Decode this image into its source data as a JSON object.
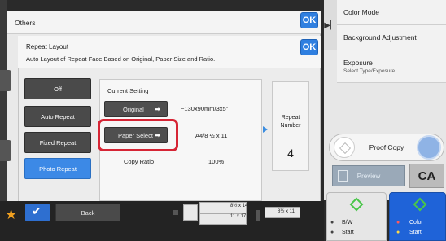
{
  "outer_dialog": {
    "title": "Others",
    "ok_label": "OK"
  },
  "inner_dialog": {
    "title": "Repeat Layout",
    "description": "Auto Layout of Repeat Face Based on Original, Paper Size and Ratio.",
    "ok_label": "OK"
  },
  "modes": [
    {
      "label": "Off",
      "active": false
    },
    {
      "label": "Auto Repeat",
      "active": false
    },
    {
      "label": "Fixed Repeat",
      "active": false
    },
    {
      "label": "Photo Repeat",
      "active": true
    }
  ],
  "current_setting": {
    "title": "Current Setting",
    "original_label": "Original",
    "original_value": "~130x90mm/3x5\"",
    "paper_select_label": "Paper Select",
    "paper_select_value": "A4/8 ½ x 11",
    "copy_ratio_label": "Copy Ratio",
    "copy_ratio_value": "100%"
  },
  "repeat_number": {
    "label": "Repeat Number",
    "value": "4"
  },
  "right_panel": {
    "color_mode": "Color Mode",
    "background_adjustment": "Background Adjustment",
    "exposure": "Exposure",
    "exposure_sub": "Select Type/Exposure",
    "proof_copy": "Proof Copy",
    "preview": "Preview",
    "ca": "CA",
    "bw_start": {
      "line1": "B/W",
      "line2": "Start"
    },
    "color_start": {
      "line1": "Color",
      "line2": "Start"
    }
  },
  "taskbar": {
    "back_label": "Back",
    "paper1": "8½ x 14",
    "paper2": "11 x 17",
    "paper3": "8½ x 11"
  },
  "colors": {
    "accent": "#3c89e6",
    "highlight": "#d62535",
    "ok": "#2f7fe0",
    "start_green": "#49c649",
    "color_start": "#1f63d8"
  }
}
